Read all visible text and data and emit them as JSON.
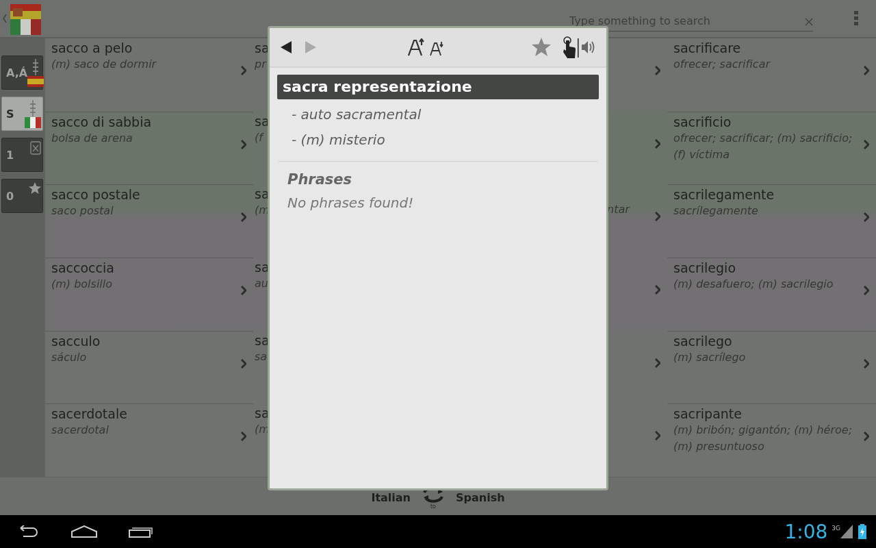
{
  "top_bar": {
    "search": {
      "placeholder": "Type something to search"
    }
  },
  "sidebar": {
    "buttons": [
      {
        "label": "A,Á",
        "kind": "sort",
        "selected": false
      },
      {
        "label": "S",
        "kind": "letter",
        "selected": true
      },
      {
        "label": "1",
        "kind": "history",
        "selected": false
      },
      {
        "label": "0",
        "kind": "favorites",
        "selected": false
      }
    ]
  },
  "columns": [
    {
      "entries": [
        {
          "word": "sacco a pelo",
          "translation": "(m) saco de dormir"
        },
        {
          "word": "sacco di sabbia",
          "translation": "bolsa de arena"
        },
        {
          "word": "sacco postale",
          "translation": "saco postal"
        },
        {
          "word": "saccoccia",
          "translation": "(m) bolsillo"
        },
        {
          "word": "sacculo",
          "translation": "sáculo"
        },
        {
          "word": "sacerdotale",
          "translation": "sacerdotal"
        }
      ]
    },
    {
      "entries": [
        {
          "word": "sa",
          "translation": "pr"
        },
        {
          "word": "sa",
          "translation": "(f"
        },
        {
          "word": "sa",
          "translation": "(m"
        },
        {
          "word": "sa",
          "translation": "au"
        },
        {
          "word": "sa",
          "translation": "sa"
        },
        {
          "word": "sa",
          "translation": "(m"
        }
      ]
    },
    {
      "entries": [
        {
          "chevron": true
        },
        {
          "chevron": true
        },
        {
          "translation": "ntar",
          "chevron": true
        },
        {
          "chevron": true
        },
        {
          "chevron": true
        },
        {
          "chevron": true
        }
      ]
    },
    {
      "entries": [
        {
          "word": "sacrificare",
          "translation": "ofrecer; sacrificar"
        },
        {
          "word": "sacrificio",
          "translation": "ofrecer; sacrificar; (m) sacrificio; (f) víctima"
        },
        {
          "word": "sacrilegamente",
          "translation": "sacrílegamente"
        },
        {
          "word": "sacrilegio",
          "translation": "(m) desafuero; (m) sacrilegio"
        },
        {
          "word": "sacrilego",
          "translation": "(m) sacrílego"
        },
        {
          "word": "sacripante",
          "translation": "(m) bribón; gigantón; (m) héroe; (m) presuntuoso"
        }
      ]
    }
  ],
  "popup": {
    "back": {
      "disabled": false
    },
    "forward": {
      "disabled": true
    },
    "favorite": false,
    "headword": "sacra representazione",
    "translations": [
      "- auto sacramental",
      "- (m) misterio"
    ],
    "phrases_heading": "Phrases",
    "phrases_empty": "No phrases found!"
  },
  "language_bar": {
    "from": "Italian",
    "to_label": "to",
    "to": "Spanish"
  },
  "nav_bar": {
    "time": "1:08",
    "network": "3G"
  }
}
